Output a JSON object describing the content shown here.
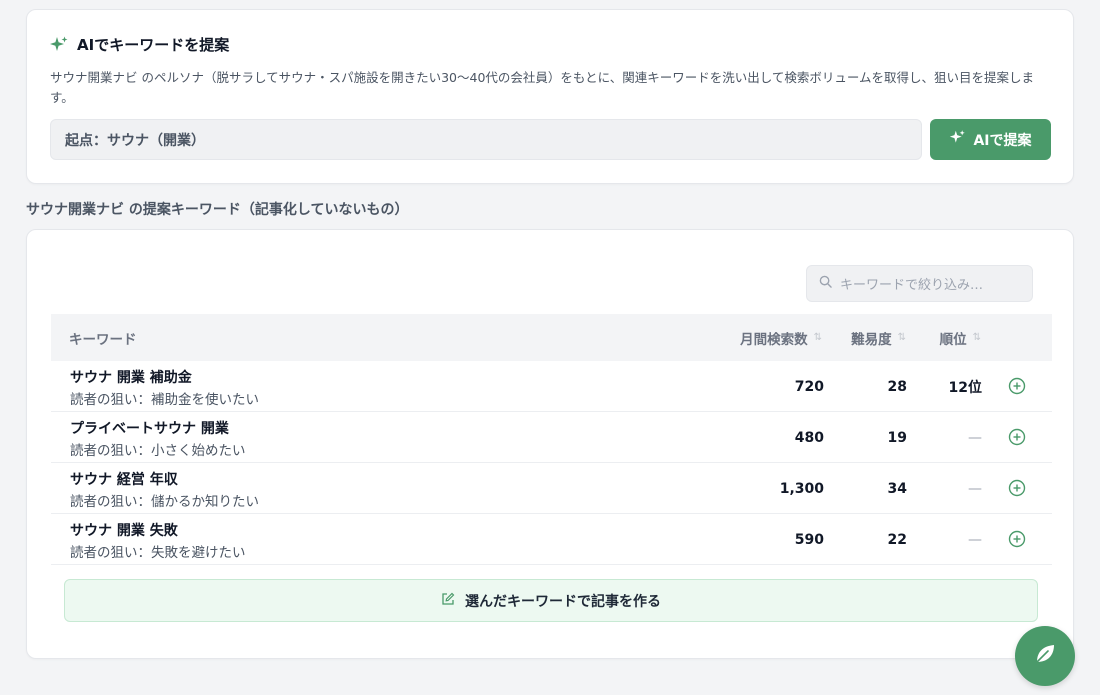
{
  "ai_panel": {
    "title": "AIでキーワードを提案",
    "description": "サウナ開業ナビ のペルソナ（脱サラしてサウナ・スパ施設を開きたい30〜40代の会社員）をもとに、関連キーワードを洗い出して検索ボリュームを取得し、狙い目を提案します。",
    "seed_value": "起点：サウナ（開業）",
    "suggest_button": "AIで提案"
  },
  "section_heading": "サウナ開業ナビ の提案キーワード（記事化していないもの）",
  "filter": {
    "placeholder": "キーワードで絞り込み…"
  },
  "table": {
    "headers": {
      "keyword": "キーワード",
      "volume": "月間検索数",
      "difficulty": "難易度",
      "rank": "順位"
    },
    "rows": [
      {
        "keyword": "サウナ 開業 補助金",
        "intent": "読者の狙い：補助金を使いたい",
        "volume": "720",
        "difficulty": "28",
        "rank": "12位"
      },
      {
        "keyword": "プライベートサウナ 開業",
        "intent": "読者の狙い：小さく始めたい",
        "volume": "480",
        "difficulty": "19",
        "rank": "—"
      },
      {
        "keyword": "サウナ 経営 年収",
        "intent": "読者の狙い：儲かるか知りたい",
        "volume": "1,300",
        "difficulty": "34",
        "rank": "—"
      },
      {
        "keyword": "サウナ 開業 失敗",
        "intent": "読者の狙い：失敗を避けたい",
        "volume": "590",
        "difficulty": "22",
        "rank": "—"
      }
    ]
  },
  "create_button": "選んだキーワードで記事を作る",
  "colors": {
    "accent": "#4a9a6a",
    "accent_light": "#edf9f1"
  },
  "icons": {
    "title": "sparkle-icon",
    "suggest": "sparkle-icon",
    "filter": "search-icon",
    "add": "plus-circle-icon",
    "create": "edit-icon",
    "fab": "leaf-icon"
  }
}
